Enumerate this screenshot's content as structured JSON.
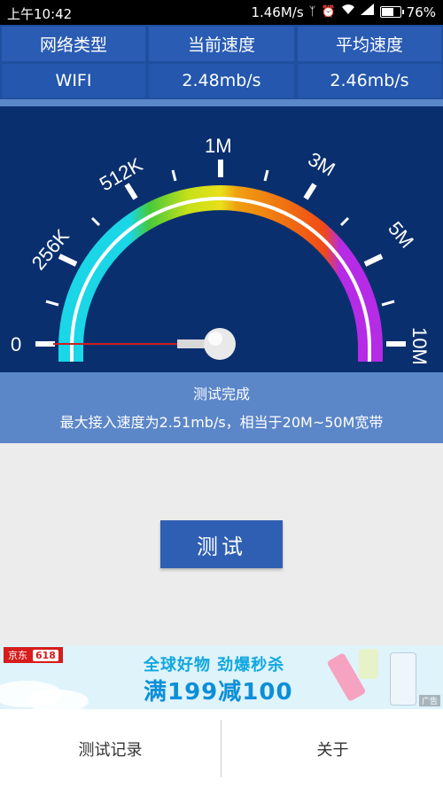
{
  "status_bar": {
    "time": "上午10:42",
    "net_speed": "1.46M/s",
    "battery": "76%",
    "battery_level": 0.76,
    "icons": [
      "bluetooth-icon",
      "alarm-icon",
      "wifi-icon",
      "signal-icon",
      "battery-icon"
    ]
  },
  "info_table": {
    "headers": [
      "网络类型",
      "当前速度",
      "平均速度"
    ],
    "values": [
      "WIFI",
      "2.48mb/s",
      "2.46mb/s"
    ]
  },
  "gauge": {
    "scale_labels": [
      "0",
      "256K",
      "512K",
      "1M",
      "3M",
      "5M",
      "10M"
    ],
    "needle_value": "0",
    "colors": {
      "background": "#0a2f6e",
      "needle": "#cc1f1f",
      "segments": [
        "#1ad6e6",
        "#46c93a",
        "#e3e01a",
        "#f0a010",
        "#f06a12",
        "#b52be6"
      ]
    }
  },
  "result": {
    "status": "测试完成",
    "summary": "最大接入速度为2.51mb/s，相当于20M~50M宽带"
  },
  "test_button": {
    "label": "测试"
  },
  "ad": {
    "brand": "京东",
    "brand_tag": "618",
    "line1": "全球好物 劲爆秒杀",
    "line2": "满199减100",
    "ad_label": "广告"
  },
  "bottom_nav": {
    "left": "测试记录",
    "right": "关于"
  }
}
